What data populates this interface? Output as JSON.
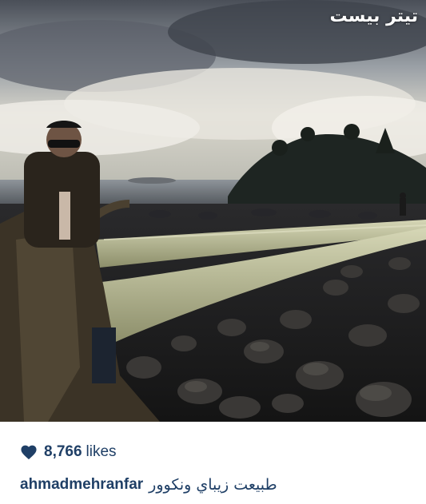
{
  "photo": {
    "description_icon": "photo",
    "watermark": "تیتر بیست"
  },
  "post": {
    "likes_count": "8,766",
    "likes_label": "likes",
    "username": "ahmadmehranfar",
    "caption": "طبيعت زيباي ونكوور"
  },
  "colors": {
    "accent": "#1f3f66",
    "heart": "#1f3f66",
    "background": "#ffffff"
  }
}
